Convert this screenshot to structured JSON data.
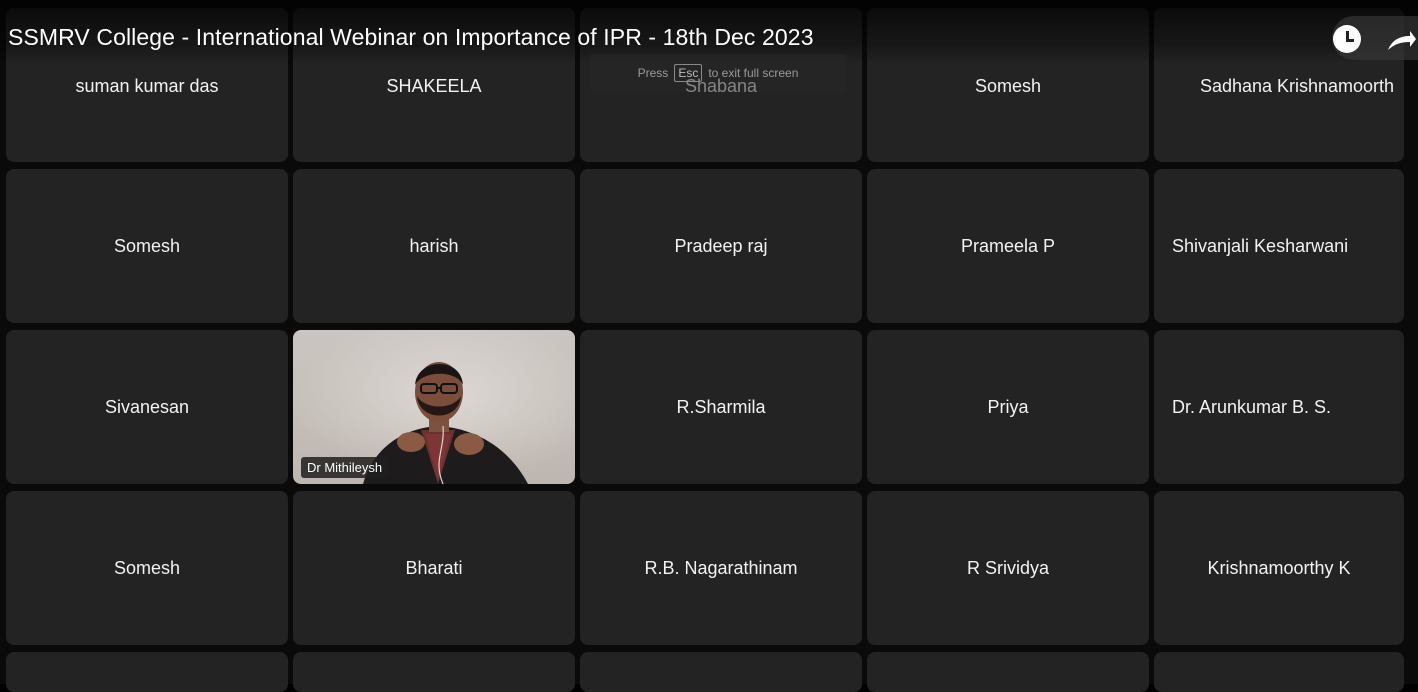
{
  "title": "SSMRV College - International Webinar on Importance of IPR - 18th Dec 2023",
  "fullscreen_hint": {
    "prefix": "Press",
    "key": "Esc",
    "suffix": "to exit full screen"
  },
  "participants": {
    "row1": [
      "suman kumar das",
      "SHAKEELA",
      "Shabana",
      "Somesh",
      "Sadhana Krishnamoorth"
    ],
    "row2": [
      "Somesh",
      "harish",
      "Pradeep raj",
      "Prameela P",
      "Shivanjali Kesharwani"
    ],
    "row3": [
      "Sivanesan",
      "Dr Mithileysh",
      "R.Sharmila",
      "Priya",
      "Dr. Arunkumar B. S."
    ],
    "row4": [
      "Somesh",
      "Bharati",
      "R.B. Nagarathinam",
      "R Srividya",
      "Krishnamoorthy K"
    ]
  },
  "icons": {
    "clock": "clock-icon",
    "share": "share-icon",
    "speaker_video": "person-video"
  },
  "colors": {
    "tile_bg": "#232323",
    "page_bg": "#0a0a0a",
    "text": "#f2f2f2"
  }
}
